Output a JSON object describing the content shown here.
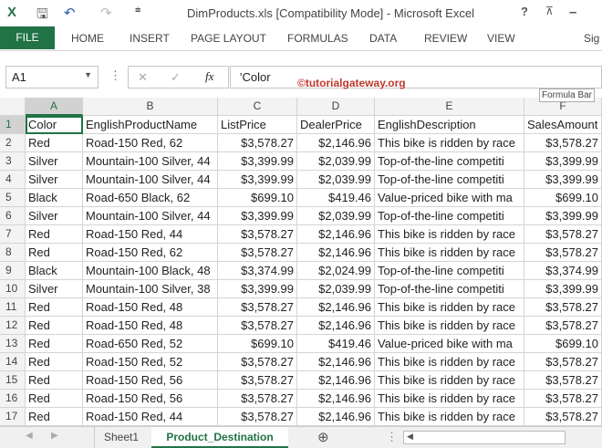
{
  "window": {
    "title": "DimProducts.xls  [Compatibility Mode] - Microsoft Excel",
    "help": "?",
    "minimize": "–"
  },
  "ribbon": {
    "file": "FILE",
    "tabs": [
      "HOME",
      "INSERT",
      "PAGE LAYOUT",
      "FORMULAS",
      "DATA",
      "REVIEW",
      "VIEW"
    ],
    "sign_in": "Sig"
  },
  "formula_bar": {
    "name_box": "A1",
    "fx": "fx",
    "value": "'Color",
    "tooltip": "Formula Bar",
    "cancel": "✕",
    "enter": "✓"
  },
  "watermark": "©tutorialgateway.org",
  "columns": [
    "A",
    "B",
    "C",
    "D",
    "E",
    "F"
  ],
  "rows": [
    [
      "1",
      "Color",
      "EnglishProductName",
      "ListPrice",
      "DealerPrice",
      "EnglishDescription",
      "SalesAmount"
    ],
    [
      "2",
      "Red",
      "Road-150 Red, 62",
      "$3,578.27",
      "$2,146.96",
      "This bike is ridden by race",
      "$3,578.27"
    ],
    [
      "3",
      "Silver",
      "Mountain-100 Silver, 44",
      "$3,399.99",
      "$2,039.99",
      "Top-of-the-line competiti",
      "$3,399.99"
    ],
    [
      "4",
      "Silver",
      "Mountain-100 Silver, 44",
      "$3,399.99",
      "$2,039.99",
      "Top-of-the-line competiti",
      "$3,399.99"
    ],
    [
      "5",
      "Black",
      "Road-650 Black, 62",
      "$699.10",
      "$419.46",
      "Value-priced bike with ma",
      "$699.10"
    ],
    [
      "6",
      "Silver",
      "Mountain-100 Silver, 44",
      "$3,399.99",
      "$2,039.99",
      "Top-of-the-line competiti",
      "$3,399.99"
    ],
    [
      "7",
      "Red",
      "Road-150 Red, 44",
      "$3,578.27",
      "$2,146.96",
      "This bike is ridden by race",
      "$3,578.27"
    ],
    [
      "8",
      "Red",
      "Road-150 Red, 62",
      "$3,578.27",
      "$2,146.96",
      "This bike is ridden by race",
      "$3,578.27"
    ],
    [
      "9",
      "Black",
      "Mountain-100 Black, 48",
      "$3,374.99",
      "$2,024.99",
      "Top-of-the-line competiti",
      "$3,374.99"
    ],
    [
      "10",
      "Silver",
      "Mountain-100 Silver, 38",
      "$3,399.99",
      "$2,039.99",
      "Top-of-the-line competiti",
      "$3,399.99"
    ],
    [
      "11",
      "Red",
      "Road-150 Red, 48",
      "$3,578.27",
      "$2,146.96",
      "This bike is ridden by race",
      "$3,578.27"
    ],
    [
      "12",
      "Red",
      "Road-150 Red, 48",
      "$3,578.27",
      "$2,146.96",
      "This bike is ridden by race",
      "$3,578.27"
    ],
    [
      "13",
      "Red",
      "Road-650 Red, 52",
      "$699.10",
      "$419.46",
      "Value-priced bike with ma",
      "$699.10"
    ],
    [
      "14",
      "Red",
      "Road-150 Red, 52",
      "$3,578.27",
      "$2,146.96",
      "This bike is ridden by race",
      "$3,578.27"
    ],
    [
      "15",
      "Red",
      "Road-150 Red, 56",
      "$3,578.27",
      "$2,146.96",
      "This bike is ridden by race",
      "$3,578.27"
    ],
    [
      "16",
      "Red",
      "Road-150 Red, 56",
      "$3,578.27",
      "$2,146.96",
      "This bike is ridden by race",
      "$3,578.27"
    ],
    [
      "17",
      "Red",
      "Road-150 Red, 44",
      "$3,578.27",
      "$2,146.96",
      "This bike is ridden by race",
      "$3,578.27"
    ]
  ],
  "sheets": [
    "Sheet1",
    "Product_Destination"
  ],
  "colors": {
    "accent": "#217346"
  }
}
